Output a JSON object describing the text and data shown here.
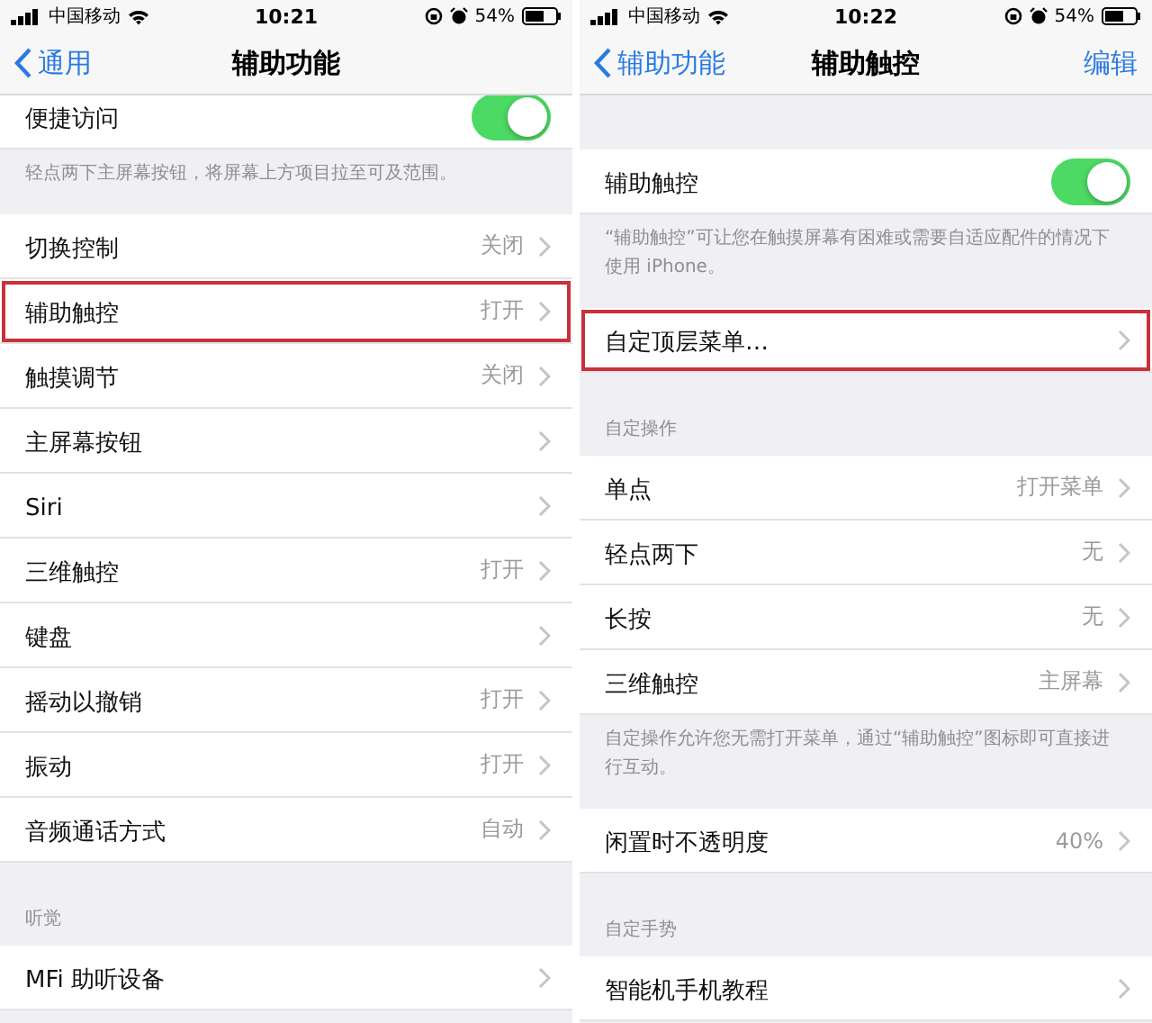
{
  "screens": [
    {
      "status_bar": {
        "carrier": "中国移动",
        "time": "10:21",
        "battery": "54%"
      },
      "nav": {
        "back": "通用",
        "title": "辅助功能"
      },
      "sections": [
        {
          "rows": [
            {
              "kind": "toggle",
              "label": "便捷访问",
              "on": true,
              "highlighted": false
            }
          ],
          "footer": "轻点两下主屏幕按钮，将屏幕上方项目拉至可及范围。"
        },
        {
          "rows": [
            {
              "kind": "disclosure",
              "label": "切换控制",
              "value": "关闭",
              "highlighted": false
            },
            {
              "kind": "disclosure",
              "label": "辅助触控",
              "value": "打开",
              "highlighted": true
            },
            {
              "kind": "disclosure",
              "label": "触摸调节",
              "value": "关闭",
              "highlighted": false
            },
            {
              "kind": "disclosure",
              "label": "主屏幕按钮",
              "highlighted": false
            },
            {
              "kind": "disclosure",
              "label": "Siri",
              "highlighted": false
            },
            {
              "kind": "disclosure",
              "label": "三维触控",
              "value": "打开",
              "highlighted": false
            },
            {
              "kind": "disclosure",
              "label": "键盘",
              "highlighted": false
            },
            {
              "kind": "disclosure",
              "label": "摇动以撤销",
              "value": "打开",
              "highlighted": false
            },
            {
              "kind": "disclosure",
              "label": "振动",
              "value": "打开",
              "highlighted": false
            },
            {
              "kind": "disclosure",
              "label": "音频通话方式",
              "value": "自动",
              "highlighted": false
            }
          ]
        },
        {
          "header": "听觉",
          "rows": [
            {
              "kind": "disclosure",
              "label": "MFi 助听设备",
              "highlighted": false
            }
          ]
        }
      ]
    },
    {
      "status_bar": {
        "carrier": "中国移动",
        "time": "10:22",
        "battery": "54%"
      },
      "nav": {
        "back": "辅助功能",
        "title": "辅助触控",
        "action": "编辑"
      },
      "sections": [
        {
          "rows": [
            {
              "kind": "toggle",
              "label": "辅助触控",
              "on": true,
              "highlighted": false
            }
          ],
          "footer": "“辅助触控”可让您在触摸屏幕有困难或需要自适应配件的情况下使用 iPhone。"
        },
        {
          "rows": [
            {
              "kind": "disclosure",
              "label": "自定顶层菜单…",
              "highlighted": true
            }
          ]
        },
        {
          "header": "自定操作",
          "rows": [
            {
              "kind": "disclosure",
              "label": "单点",
              "value": "打开菜单",
              "highlighted": false
            },
            {
              "kind": "disclosure",
              "label": "轻点两下",
              "value": "无",
              "highlighted": false
            },
            {
              "kind": "disclosure",
              "label": "长按",
              "value": "无",
              "highlighted": false
            },
            {
              "kind": "disclosure",
              "label": "三维触控",
              "value": "主屏幕",
              "highlighted": false
            }
          ],
          "footer": "自定操作允许您无需打开菜单，通过“辅助触控”图标即可直接进行互动。"
        },
        {
          "rows": [
            {
              "kind": "disclosure",
              "label": "闲置时不透明度",
              "value": "40%",
              "highlighted": false
            }
          ]
        },
        {
          "header": "自定手势",
          "rows": [
            {
              "kind": "disclosure",
              "label": "智能机手机教程",
              "highlighted": false
            }
          ]
        }
      ]
    }
  ]
}
